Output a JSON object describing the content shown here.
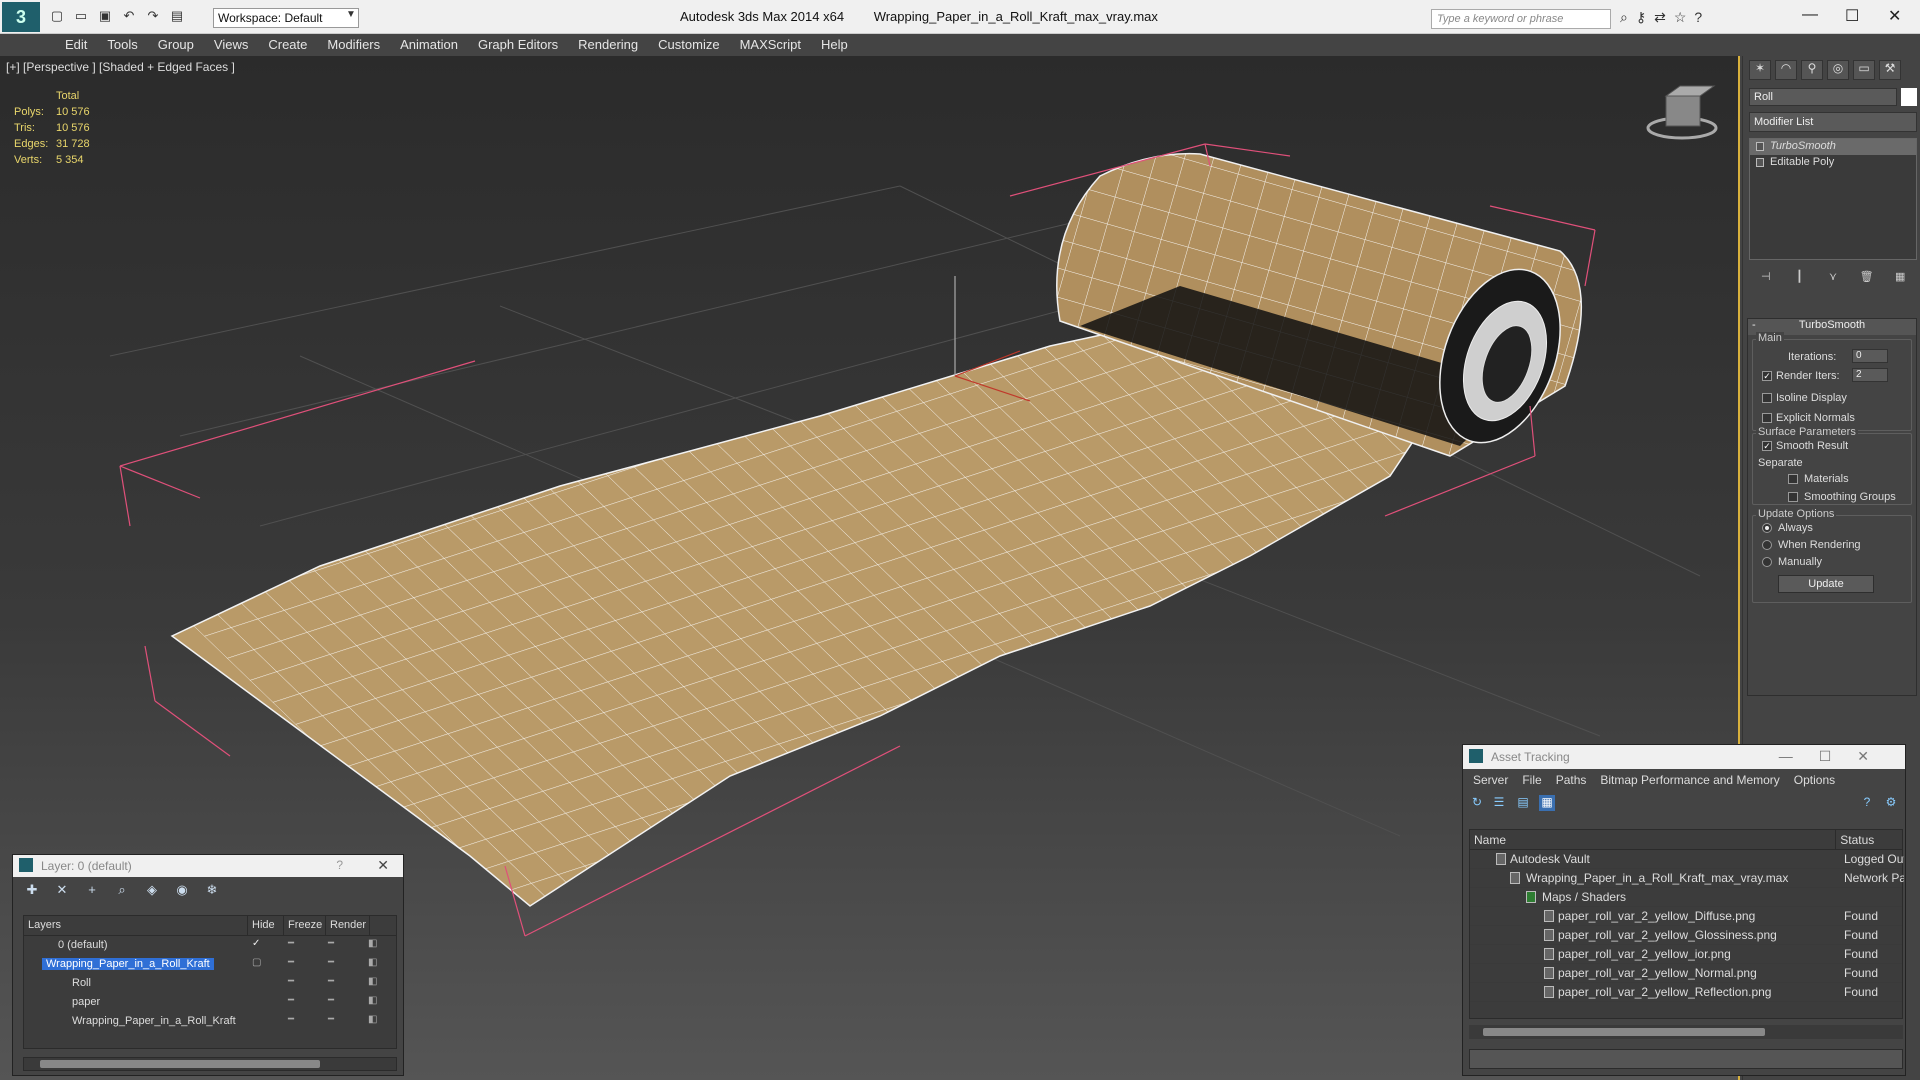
{
  "titlebar": {
    "workspace": "Workspace: Default",
    "app_name": "Autodesk 3ds Max  2014 x64",
    "file_name": "Wrapping_Paper_in_a_Roll_Kraft_max_vray.max",
    "search_placeholder": "Type a keyword or phrase"
  },
  "menu": [
    "Edit",
    "Tools",
    "Group",
    "Views",
    "Create",
    "Modifiers",
    "Animation",
    "Graph Editors",
    "Rendering",
    "Customize",
    "MAXScript",
    "Help"
  ],
  "viewport": {
    "label": "[+] [Perspective ] [Shaded + Edged Faces ]",
    "stats_header": "Total",
    "stats": [
      {
        "k": "Polys:",
        "v": "10 576"
      },
      {
        "k": "Tris:",
        "v": "10 576"
      },
      {
        "k": "Edges:",
        "v": "31 728"
      },
      {
        "k": "Verts:",
        "v": "5 354"
      }
    ]
  },
  "command_panel": {
    "object_name": "Roll",
    "modifier_list": "Modifier List",
    "stack": [
      "TurboSmooth",
      "Editable Poly"
    ],
    "rollout_title": "TurboSmooth",
    "main_group": "Main",
    "iterations_label": "Iterations:",
    "iterations_value": "0",
    "render_iters_label": "Render Iters:",
    "render_iters_value": "2",
    "isoline": "Isoline Display",
    "explicit_normals": "Explicit Normals",
    "surface_params": "Surface Parameters",
    "smooth_result": "Smooth Result",
    "separate": "Separate",
    "materials": "Materials",
    "smoothing_groups": "Smoothing Groups",
    "update_options": "Update Options",
    "always": "Always",
    "when_rendering": "When Rendering",
    "manually": "Manually",
    "update_button": "Update"
  },
  "layer_dialog": {
    "title": "Layer: 0 (default)",
    "help": "?",
    "columns": [
      "Layers",
      "Hide",
      "Freeze",
      "Render"
    ],
    "rows": [
      {
        "name": "0 (default)",
        "indent": 0
      },
      {
        "name": "Wrapping_Paper_in_a_Roll_Kraft",
        "indent": 0
      },
      {
        "name": "Roll",
        "indent": 1
      },
      {
        "name": "paper",
        "indent": 1
      },
      {
        "name": "Wrapping_Paper_in_a_Roll_Kraft",
        "indent": 1
      }
    ]
  },
  "asset_tracking": {
    "title": "Asset Tracking",
    "menu": [
      "Server",
      "File",
      "Paths",
      "Bitmap Performance and Memory",
      "Options"
    ],
    "columns": [
      "Name",
      "Status"
    ],
    "rows": [
      {
        "name": "Autodesk Vault",
        "status": "Logged Out",
        "indent": 1
      },
      {
        "name": "Wrapping_Paper_in_a_Roll_Kraft_max_vray.max",
        "status": "Network Pa",
        "indent": 2
      },
      {
        "name": "Maps / Shaders",
        "status": "",
        "indent": 3
      },
      {
        "name": "paper_roll_var_2_yellow_Diffuse.png",
        "status": "Found",
        "indent": 4
      },
      {
        "name": "paper_roll_var_2_yellow_Glossiness.png",
        "status": "Found",
        "indent": 4
      },
      {
        "name": "paper_roll_var_2_yellow_ior.png",
        "status": "Found",
        "indent": 4
      },
      {
        "name": "paper_roll_var_2_yellow_Normal.png",
        "status": "Found",
        "indent": 4
      },
      {
        "name": "paper_roll_var_2_yellow_Reflection.png",
        "status": "Found",
        "indent": 4
      }
    ]
  },
  "colors": {
    "stats": "#e9d66b",
    "selection": "#2f6fd6",
    "viewport_border": "#d9b13c",
    "paper": "#b99a68",
    "bounding_box": "#e0507a"
  }
}
